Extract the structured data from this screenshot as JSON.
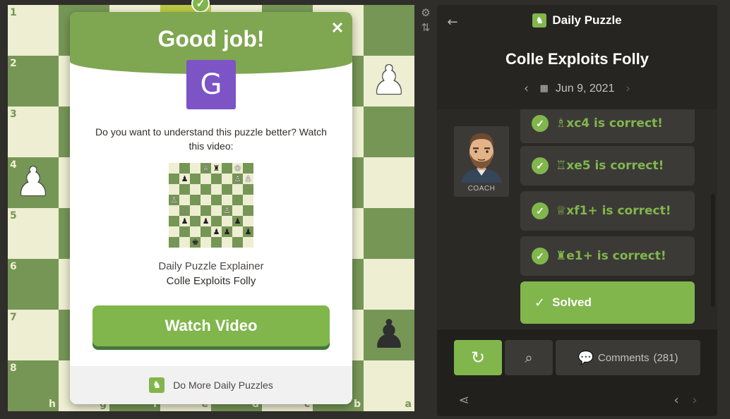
{
  "board": {
    "rank_labels": [
      "1",
      "2",
      "3",
      "4",
      "5",
      "6",
      "7",
      "8"
    ],
    "file_labels": [
      "h",
      "g",
      "f",
      "e",
      "d",
      "c",
      "b",
      "a"
    ],
    "light_color": "#eeeed2",
    "dark_color": "#769656",
    "highlight_color": "#baca44",
    "pieces": [
      {
        "rank": 1,
        "file": "g",
        "glyph": "♜",
        "color": "white"
      },
      {
        "rank": 1,
        "file": "b",
        "glyph": "♜",
        "color": "white"
      },
      {
        "rank": 2,
        "file": "a",
        "glyph": "♟",
        "color": "white"
      },
      {
        "rank": 4,
        "file": "h",
        "glyph": "♟",
        "color": "white"
      },
      {
        "rank": 5,
        "file": "g",
        "glyph": "♟",
        "color": "white"
      },
      {
        "rank": 7,
        "file": "a",
        "glyph": "♟",
        "color": "black"
      },
      {
        "rank": 8,
        "file": "g",
        "glyph": "♟",
        "color": "black"
      }
    ],
    "success_badge": "check-icon"
  },
  "tools": {
    "settings_icon": "gear-icon",
    "flip_icon": "flip-board-icon"
  },
  "modal": {
    "title": "Good job!",
    "close_icon": "close-icon",
    "grade": "G",
    "grade_color": "#7d54c6",
    "question": "Do you want to understand this puzzle better? Watch this video:",
    "mini_board": [
      [
        "",
        "",
        "",
        "♕",
        "♜",
        "",
        "♔",
        ""
      ],
      [
        "",
        "♟",
        "",
        "",
        "",
        "",
        "♙",
        "♙"
      ],
      [
        "",
        "",
        "",
        "",
        "",
        "",
        "",
        ""
      ],
      [
        "♙",
        "",
        "",
        "",
        "",
        "",
        "",
        ""
      ],
      [
        "",
        "♘",
        "",
        "",
        "",
        "♙",
        "",
        ""
      ],
      [
        "",
        "♟",
        "",
        "♟",
        "",
        "",
        "♟",
        ""
      ],
      [
        "",
        "",
        "",
        "",
        "♟",
        "♟",
        "",
        "♟"
      ],
      [
        "",
        "",
        "♚",
        "",
        "",
        "",
        "",
        ""
      ]
    ],
    "mini_board_white": [
      [
        0,
        0,
        0,
        1,
        0,
        0,
        1,
        0
      ],
      [
        0,
        0,
        0,
        0,
        0,
        0,
        1,
        1
      ],
      [
        0,
        0,
        0,
        0,
        0,
        0,
        0,
        0
      ],
      [
        1,
        0,
        0,
        0,
        0,
        0,
        0,
        0
      ],
      [
        0,
        1,
        0,
        0,
        0,
        1,
        0,
        0
      ],
      [
        0,
        0,
        0,
        0,
        0,
        0,
        0,
        0
      ],
      [
        0,
        0,
        0,
        0,
        0,
        0,
        0,
        0
      ],
      [
        0,
        0,
        0,
        0,
        0,
        0,
        0,
        0
      ]
    ],
    "video_label": "Daily Puzzle Explainer",
    "video_title": "Colle Exploits Folly",
    "watch_button": "Watch Video",
    "more_link": "Do More Daily Puzzles",
    "accent": "#7fa650"
  },
  "panel": {
    "back_icon": "arrow-left-icon",
    "title": "Daily Puzzle",
    "title_icon": "daily-puzzle-icon",
    "puzzle_name": "Colle Exploits Folly",
    "date": "Jun 9, 2021",
    "coach_label": "COACH",
    "messages": [
      {
        "text": "♗xc4 is correct!"
      },
      {
        "text": "♖xe5 is correct!"
      },
      {
        "text": "♕xf1+ is correct!"
      },
      {
        "text": "♜e1+ is correct!"
      }
    ],
    "solved_label": "Solved",
    "comments_label": "Comments",
    "comments_count": "(281)",
    "accent": "#81b64c"
  }
}
